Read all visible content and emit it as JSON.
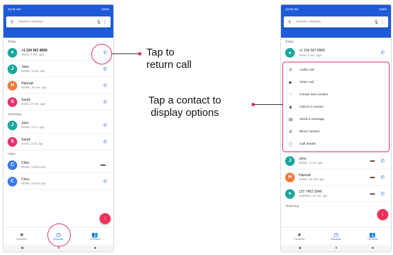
{
  "left_phone": {
    "status": {
      "time": "13:00 AM",
      "battery": "100%"
    },
    "search": {
      "placeholder": "Search contacts"
    },
    "sections": [
      {
        "title": "Today",
        "rows": [
          {
            "name": "+1 234 567-8900",
            "detail": "Tassa, 0 min. ago",
            "initial": "",
            "color": "#1aa7a0",
            "bold": true
          },
          {
            "name": "John",
            "detail": "Mobile, 4 min. ago",
            "initial": "J",
            "color": "#1aa7a0"
          },
          {
            "name": "Hannah",
            "detail": "Mobile, 20 min. ago",
            "initial": "H",
            "color": "#f2783a"
          },
          {
            "name": "Sarah",
            "detail": "Email, 14 min. ago",
            "initial": "S",
            "color": "#e6316f"
          }
        ]
      },
      {
        "title": "Yesterday",
        "rows": [
          {
            "name": "John",
            "detail": "Mobile, 14 hr. ago",
            "initial": "J",
            "color": "#1aa7a0"
          },
          {
            "name": "Sarah",
            "detail": "Email, 14 hr. ago",
            "initial": "S",
            "color": "#e6316f"
          }
        ]
      },
      {
        "title": "Older",
        "rows": [
          {
            "name": "Chris",
            "detail": "Mobile, 5 days ago",
            "initial": "C",
            "color": "#3b7be8",
            "action": "msg"
          },
          {
            "name": "Chris",
            "detail": "Mobile, 5 days ago",
            "initial": "C",
            "color": "#3b7be8"
          }
        ]
      }
    ],
    "nav": [
      "Favorites",
      "Recents",
      "Contacts"
    ]
  },
  "right_phone": {
    "status": {
      "time": "13:00 AM",
      "battery": "100%"
    },
    "search": {
      "placeholder": "Search contacts"
    },
    "section": "Today",
    "top_row": {
      "name": "+1 234 567-8900",
      "detail": "Tassa, 0 min. ago"
    },
    "options": [
      "Audio call",
      "Video call",
      "Create new contact",
      "Add to a contact",
      "Send a message",
      "Block number",
      "Call details"
    ],
    "rows": [
      {
        "name": "John",
        "detail": "Mobile, 4 min. ago",
        "initial": "J",
        "color": "#1aa7a0"
      },
      {
        "name": "Hannah",
        "detail": "Mobile, 20 min. ago",
        "initial": "H",
        "color": "#f2783a"
      },
      {
        "name": "137 7402 2546",
        "detail": "Vodafone, 11 min. ago",
        "initial": "",
        "color": "#1aa7a0"
      }
    ],
    "section2": "Yesterday",
    "nav": [
      "Favorites",
      "Recents",
      "Contacts"
    ]
  },
  "callouts": {
    "return_call": "Tap to\nreturn call",
    "contact_options": "Tap a contact to\ndisplay options"
  }
}
